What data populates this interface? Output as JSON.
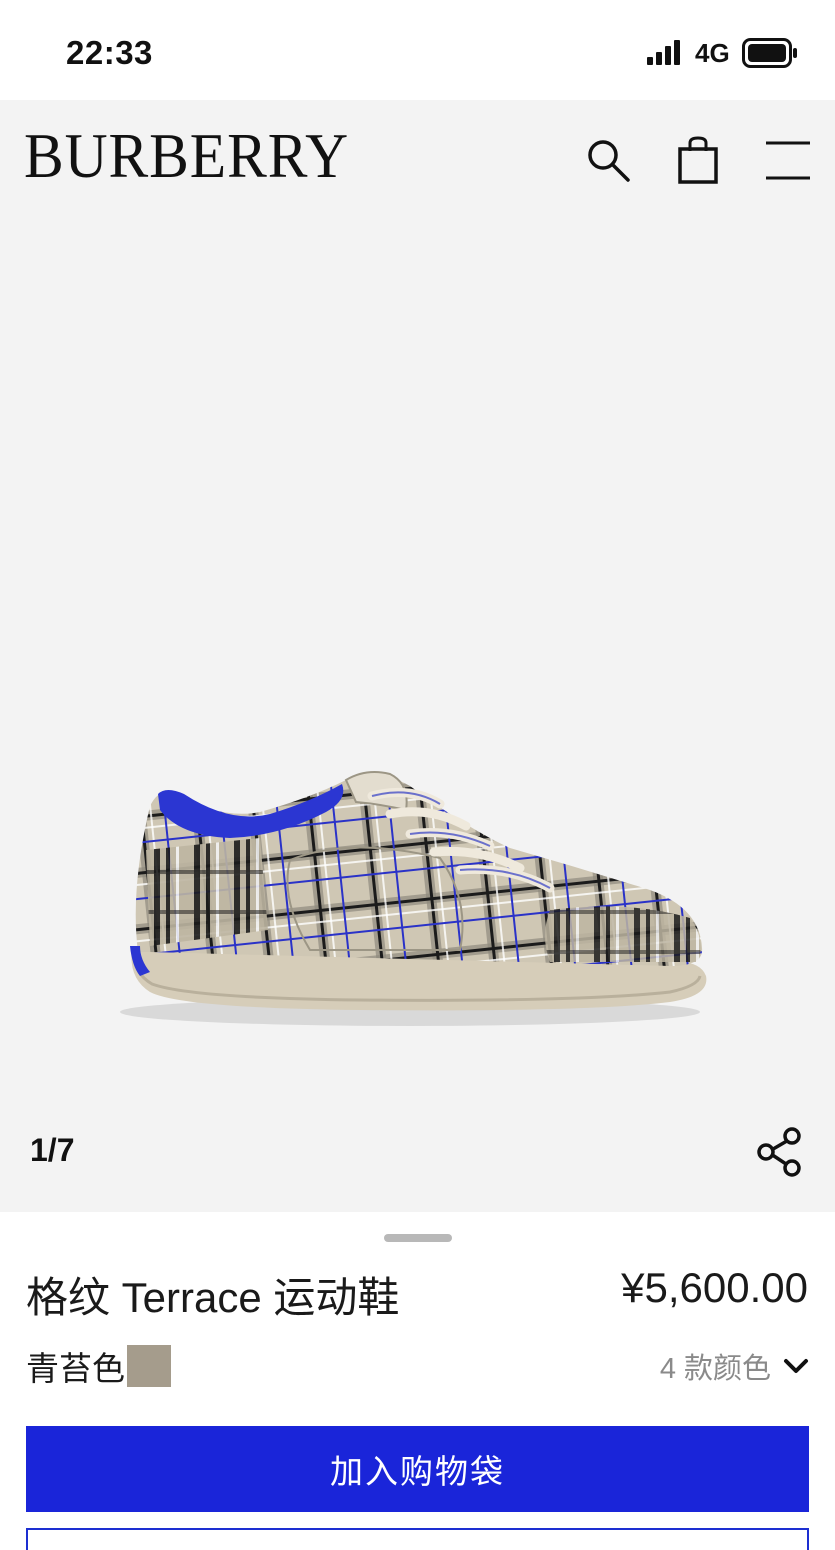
{
  "status_bar": {
    "time": "22:33",
    "network": "4G",
    "signal_icon": "cellular-signal-icon",
    "battery_icon": "battery-icon"
  },
  "header": {
    "logo": "BURBERRY",
    "icons": [
      "search-icon",
      "shopping-bag-icon",
      "menu-icon"
    ]
  },
  "gallery": {
    "counter": "1/7",
    "share_icon": "share-icon",
    "image": "plaid-sneaker"
  },
  "product": {
    "title": "格纹 Terrace 运动鞋",
    "price": "¥5,600.00",
    "color_name": "青苔色",
    "color_swatch": "#a59c8c",
    "color_count": "4 款颜色",
    "dropdown_icon": "chevron-down-icon",
    "add_to_bag": "加入购物袋"
  },
  "colors": {
    "accent": "#1a25d9",
    "background": "#f3f3f3"
  }
}
